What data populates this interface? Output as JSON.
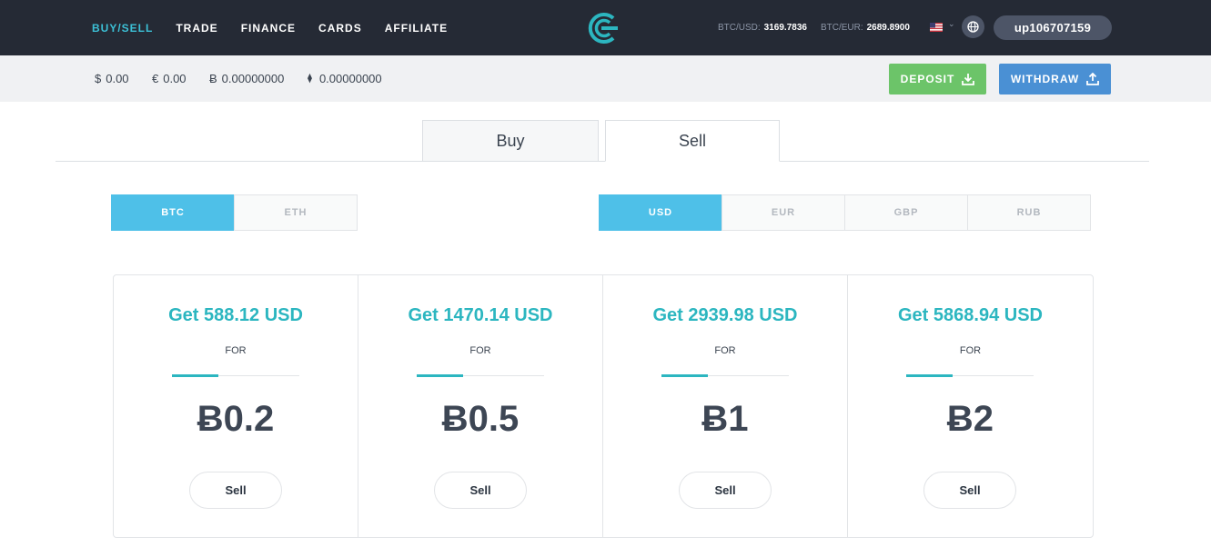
{
  "nav": {
    "items": [
      {
        "label": "BUY/SELL",
        "active": true
      },
      {
        "label": "TRADE",
        "active": false
      },
      {
        "label": "FINANCE",
        "active": false
      },
      {
        "label": "CARDS",
        "active": false
      },
      {
        "label": "AFFILIATE",
        "active": false
      }
    ],
    "logo_icon": "cex-logo-icon",
    "rates": [
      {
        "label": "BTC/USD:",
        "value": "3169.7836"
      },
      {
        "label": "BTC/EUR:",
        "value": "2689.8900"
      }
    ],
    "flag_icon": "us-flag-icon",
    "globe_icon": "globe-icon",
    "username": "up106707159"
  },
  "balances": [
    {
      "symbol": "$",
      "value": "0.00"
    },
    {
      "symbol": "€",
      "value": "0.00"
    },
    {
      "symbol": "Ƀ",
      "value": "0.00000000"
    },
    {
      "symbol": "⧫",
      "value": "0.00000000"
    }
  ],
  "actions": {
    "deposit_label": "DEPOSIT",
    "deposit_icon": "download-icon",
    "withdraw_label": "WITHDRAW",
    "withdraw_icon": "upload-icon"
  },
  "tabs": [
    {
      "label": "Buy",
      "active": false
    },
    {
      "label": "Sell",
      "active": true
    }
  ],
  "crypto_options": [
    {
      "label": "BTC",
      "active": true
    },
    {
      "label": "ETH",
      "active": false
    }
  ],
  "currency_options": [
    {
      "label": "USD",
      "active": true
    },
    {
      "label": "EUR",
      "active": false
    },
    {
      "label": "GBP",
      "active": false
    },
    {
      "label": "RUB",
      "active": false
    }
  ],
  "offers": [
    {
      "get": "Get 588.12 USD",
      "for": "FOR",
      "amount": "Ƀ0.2",
      "button": "Sell"
    },
    {
      "get": "Get 1470.14 USD",
      "for": "FOR",
      "amount": "Ƀ0.5",
      "button": "Sell"
    },
    {
      "get": "Get 2939.98 USD",
      "for": "FOR",
      "amount": "Ƀ1",
      "button": "Sell"
    },
    {
      "get": "Get 5868.94 USD",
      "for": "FOR",
      "amount": "Ƀ2",
      "button": "Sell"
    }
  ],
  "colors": {
    "nav_bg": "#252a35",
    "accent_teal": "#2cb6c0",
    "nav_active": "#3cc0d6",
    "segment_active": "#4ec0e8",
    "deposit_green": "#6cc469",
    "withdraw_blue": "#4a90d4"
  }
}
